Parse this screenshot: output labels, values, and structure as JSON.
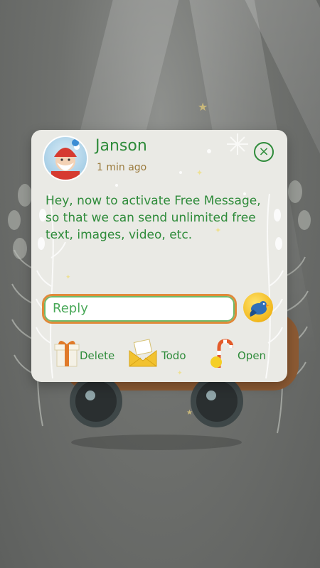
{
  "notification": {
    "sender": "Janson",
    "time": "1 min ago",
    "message": "Hey, now to activate Free Message, so that we can send unlimited free text, images, video, etc.",
    "reply_placeholder": "Reply"
  },
  "actions": [
    {
      "label": "Delete",
      "icon": "gift-box-icon"
    },
    {
      "label": "Todo",
      "icon": "envelope-icon"
    },
    {
      "label": "Open",
      "icon": "candy-cane-icon"
    }
  ],
  "colors": {
    "accent_green": "#2e8b3a",
    "time_brown": "#9a7a3c",
    "card_bg": "#eaeae5"
  }
}
